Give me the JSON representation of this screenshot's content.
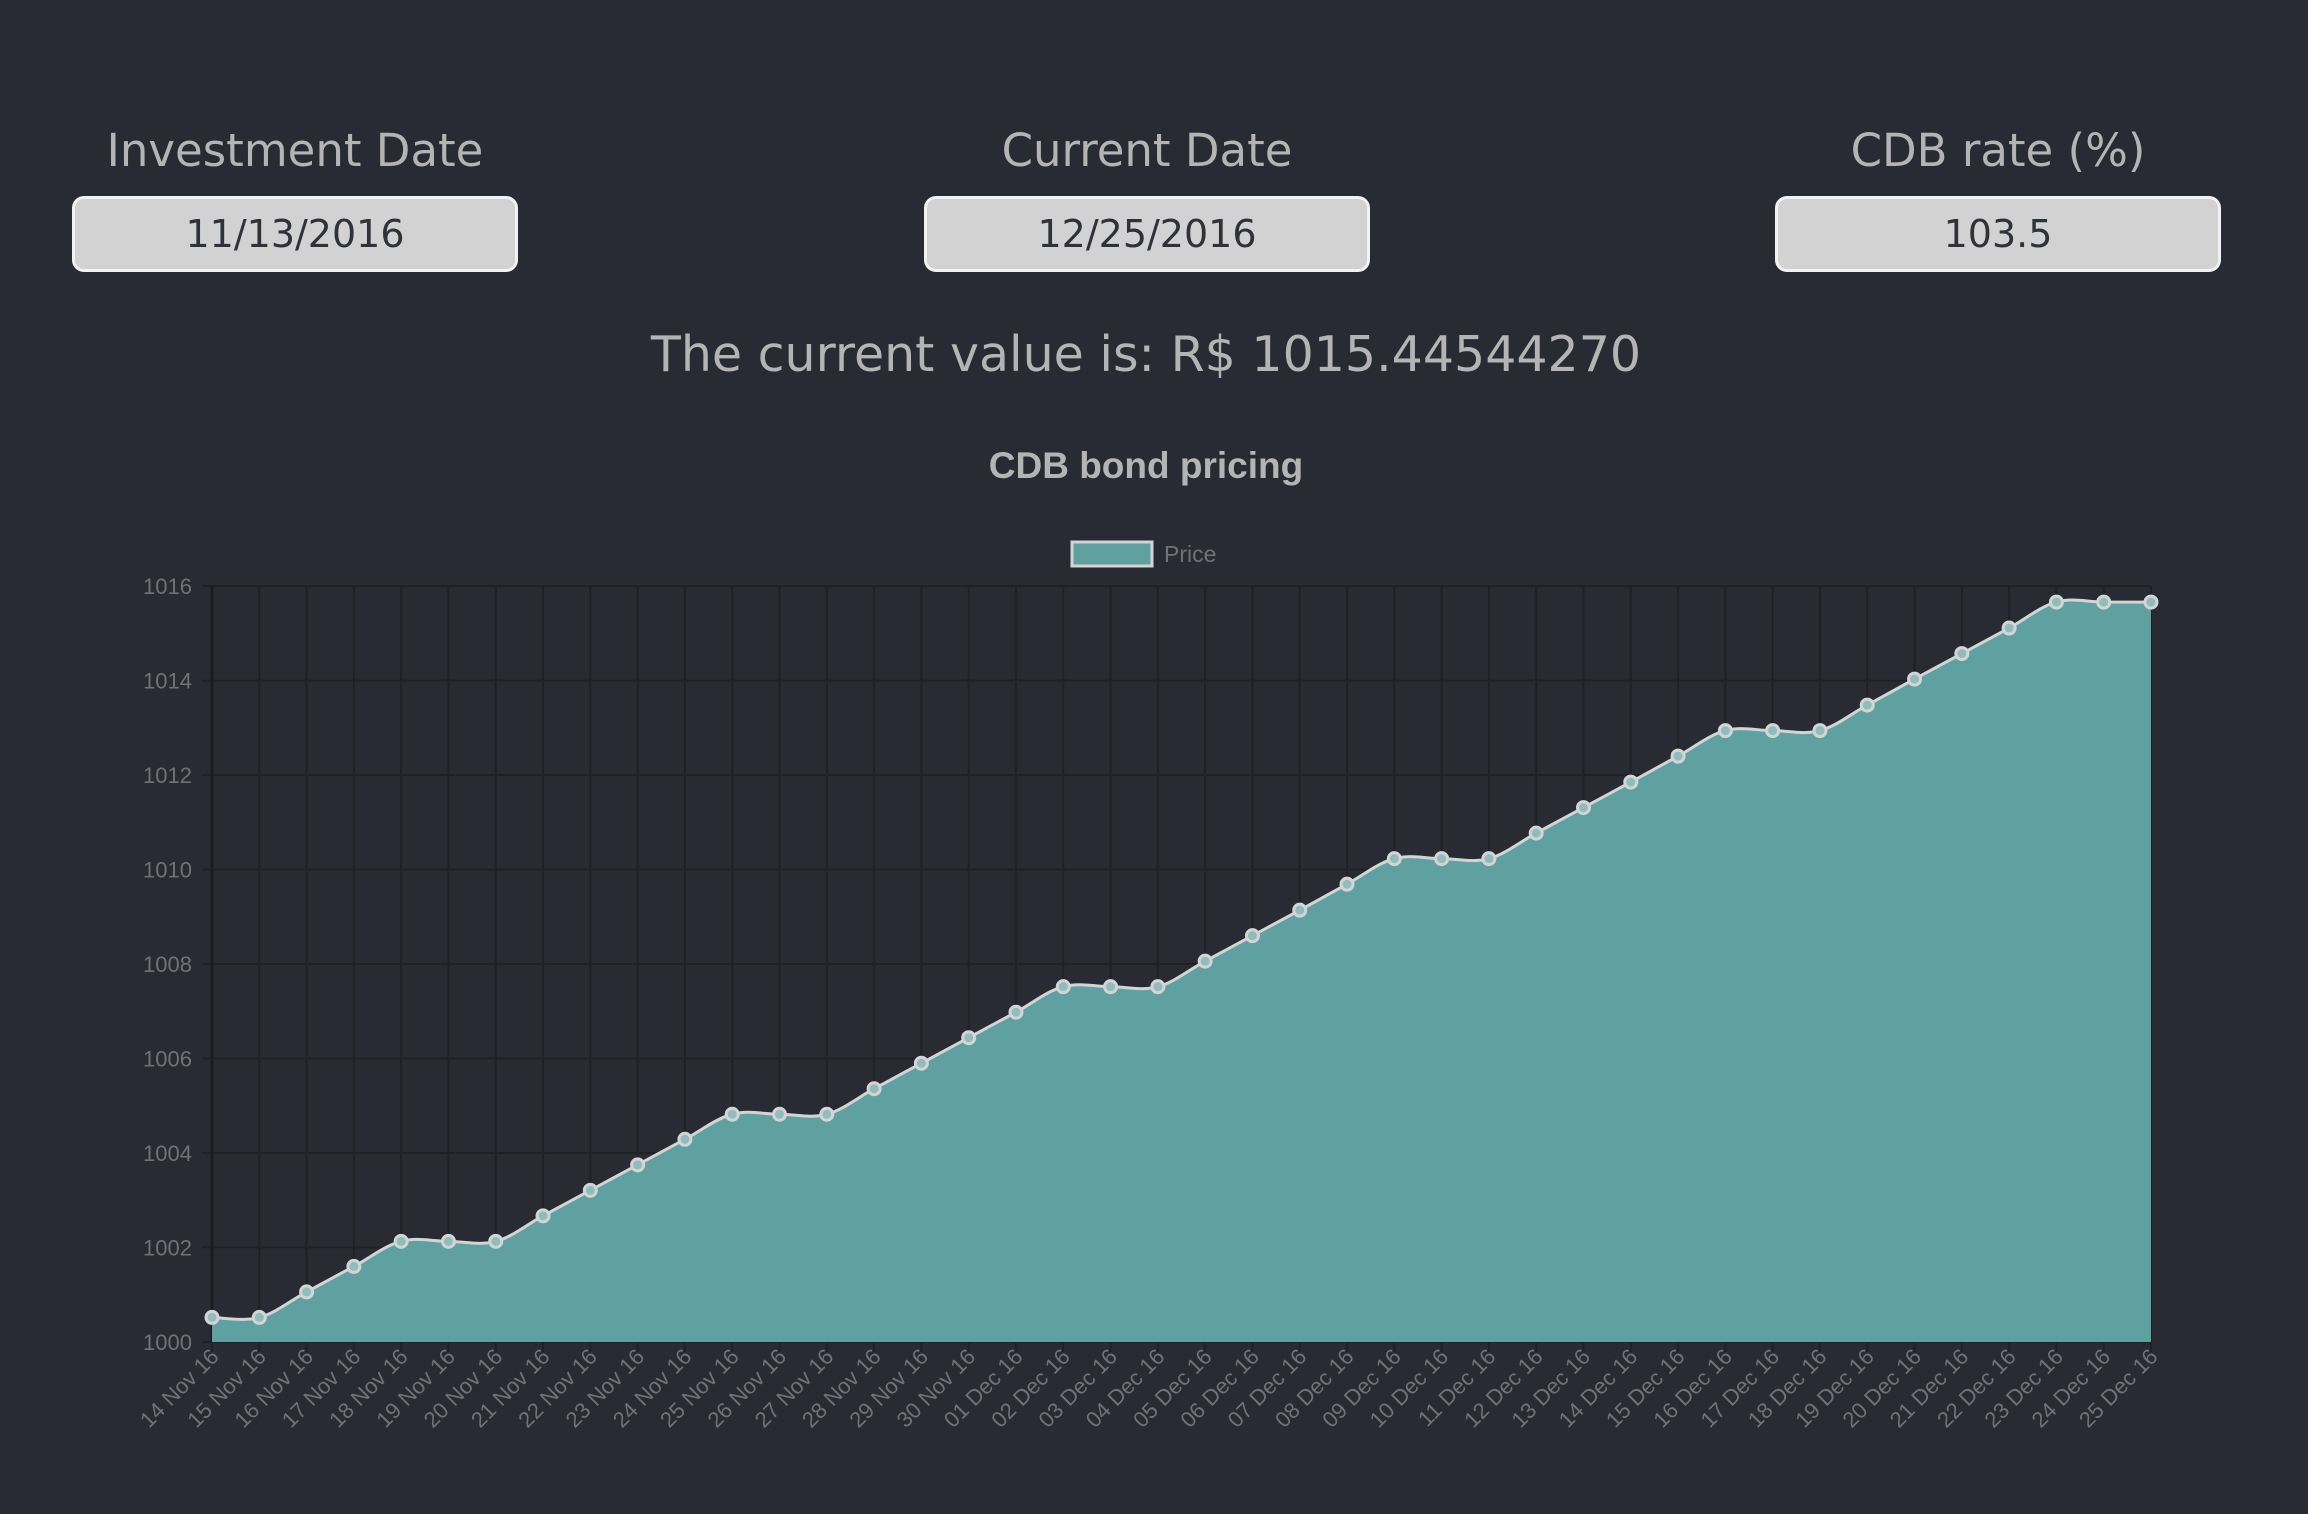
{
  "inputs": {
    "investment_date": {
      "label": "Investment Date",
      "value": "11/13/2016"
    },
    "current_date": {
      "label": "Current Date",
      "value": "12/25/2016"
    },
    "cdb_rate": {
      "label": "CDB rate (%)",
      "value": "103.5"
    }
  },
  "result": {
    "text": "The current value is: R$ 1015.44544270"
  },
  "colors": {
    "background": "#282b33",
    "fill": "#5fa1a1",
    "line": "#d4d4d4"
  },
  "chart_data": {
    "type": "area",
    "title": "CDB bond pricing",
    "legend": {
      "position": "top",
      "entries": [
        "Price"
      ]
    },
    "grid": true,
    "ylim": [
      1000,
      1016
    ],
    "yticks": [
      "1000",
      "1002",
      "1004",
      "1006",
      "1008",
      "1010",
      "1012",
      "1014",
      "1016"
    ],
    "categories": [
      "14 Nov 16",
      "15 Nov 16",
      "16 Nov 16",
      "17 Nov 16",
      "18 Nov 16",
      "19 Nov 16",
      "20 Nov 16",
      "21 Nov 16",
      "22 Nov 16",
      "23 Nov 16",
      "24 Nov 16",
      "25 Nov 16",
      "26 Nov 16",
      "27 Nov 16",
      "28 Nov 16",
      "29 Nov 16",
      "30 Nov 16",
      "01 Dec 16",
      "02 Dec 16",
      "03 Dec 16",
      "04 Dec 16",
      "05 Dec 16",
      "06 Dec 16",
      "07 Dec 16",
      "08 Dec 16",
      "09 Dec 16",
      "10 Dec 16",
      "11 Dec 16",
      "12 Dec 16",
      "13 Dec 16",
      "14 Dec 16",
      "15 Dec 16",
      "16 Dec 16",
      "17 Dec 16",
      "18 Dec 16",
      "19 Dec 16",
      "20 Dec 16",
      "21 Dec 16",
      "22 Dec 16",
      "23 Dec 16",
      "24 Dec 16",
      "25 Dec 16"
    ],
    "series": [
      {
        "name": "Price",
        "values": [
          1000.52,
          1000.52,
          1001.06,
          1001.6,
          1002.13,
          1002.13,
          1002.13,
          1002.67,
          1003.21,
          1003.75,
          1004.29,
          1004.82,
          1004.82,
          1004.82,
          1005.36,
          1005.9,
          1006.44,
          1006.98,
          1007.52,
          1007.52,
          1007.52,
          1008.06,
          1008.6,
          1009.14,
          1009.69,
          1010.23,
          1010.23,
          1010.23,
          1010.77,
          1011.31,
          1011.85,
          1012.4,
          1012.94,
          1012.94,
          1012.94,
          1013.48,
          1014.03,
          1014.57,
          1015.11,
          1015.66,
          1015.66,
          1015.66
        ]
      }
    ]
  }
}
